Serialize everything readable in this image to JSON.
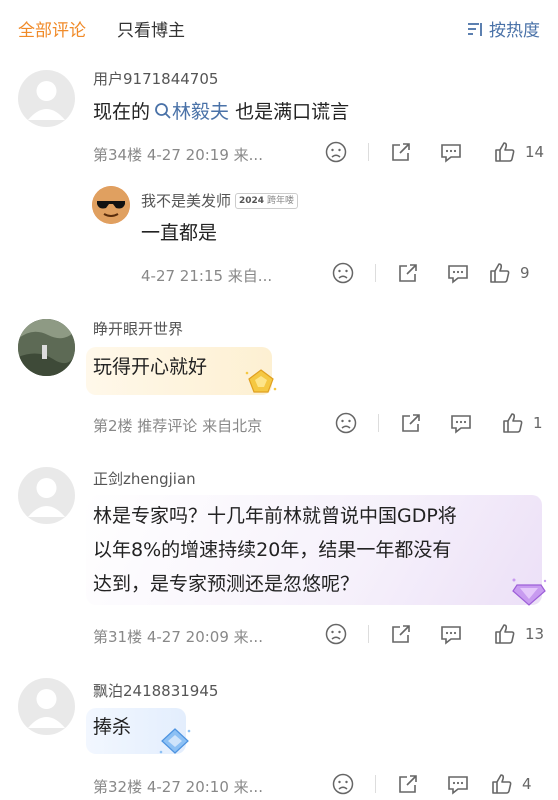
{
  "tabs": {
    "all": "全部评论",
    "blogger_only": "只看博主",
    "sort": "按热度"
  },
  "comments": [
    {
      "user": "用户9171844705",
      "content_pre": "现在的",
      "link": "林毅夫",
      "content_post": " 也是满口谎言",
      "meta": "第34楼  4-27 20:19  来...",
      "likes": "14",
      "reply": {
        "user": "我不是美发师",
        "badge_year": "2024",
        "badge_text": "跨年喽",
        "content": "一直都是",
        "meta": "4-27 21:15  来自...",
        "likes": "9"
      }
    },
    {
      "user": "睁开眼开世界",
      "content": "玩得开心就好",
      "meta": "第2楼  推荐评论  来自北京",
      "likes": "1"
    },
    {
      "user": "正剑zhengjian",
      "content_lines": [
        "林是专家吗？十几年前林就曾说中国GDP将",
        "以年8%的增速持续20年，结果一年都没有",
        "达到，是专家预测还是忽悠呢？"
      ],
      "meta": "第31楼  4-27 20:09  来...",
      "likes": "13"
    },
    {
      "user": "飘泊2418831945",
      "content": "捧杀",
      "meta": "第32楼  4-27 20:10  来...",
      "likes": "4"
    }
  ],
  "colors": {
    "accent": "#f08a28",
    "link": "#4a72a8",
    "meta": "#888888"
  }
}
